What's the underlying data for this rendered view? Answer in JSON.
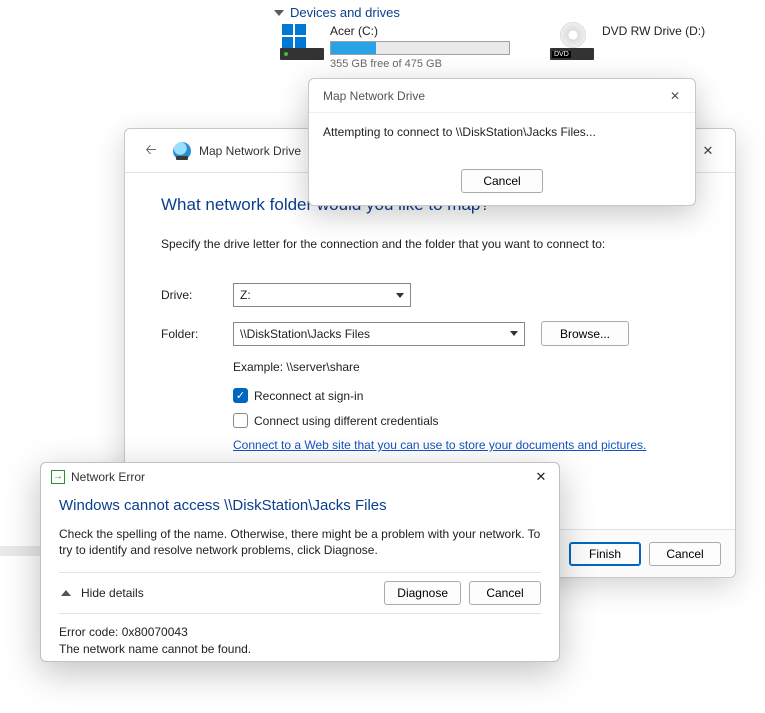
{
  "explorer": {
    "section": "Devices and drives",
    "drive_c": {
      "name": "Acer (C:)",
      "free_text": "355 GB free of 475 GB",
      "fill_pct": 25
    },
    "drive_d": {
      "name": "DVD RW Drive (D:)",
      "badge": "DVD"
    }
  },
  "connect_modal": {
    "title": "Map Network Drive",
    "message": "Attempting to connect to \\\\DiskStation\\Jacks Files...",
    "cancel": "Cancel"
  },
  "wizard": {
    "title": "Map Network Drive",
    "heading": "What network folder would you like to map?",
    "instruction": "Specify the drive letter for the connection and the folder that you want to connect to:",
    "drive_label": "Drive:",
    "drive_value": "Z:",
    "folder_label": "Folder:",
    "folder_value": "\\\\DiskStation\\Jacks Files",
    "browse": "Browse...",
    "example": "Example: \\\\server\\share",
    "reconnect": "Reconnect at sign-in",
    "diff_creds": "Connect using different credentials",
    "weblink": "Connect to a Web site that you can use to store your documents and pictures.",
    "finish": "Finish",
    "cancel": "Cancel"
  },
  "error": {
    "title": "Network Error",
    "heading": "Windows cannot access \\\\DiskStation\\Jacks Files",
    "body": "Check the spelling of the name. Otherwise, there might be a problem with your network. To try to identify and resolve network problems, click Diagnose.",
    "hide": "Hide details",
    "diagnose": "Diagnose",
    "cancel": "Cancel",
    "code": "Error code: 0x80070043",
    "msg": "The network name cannot be found."
  }
}
